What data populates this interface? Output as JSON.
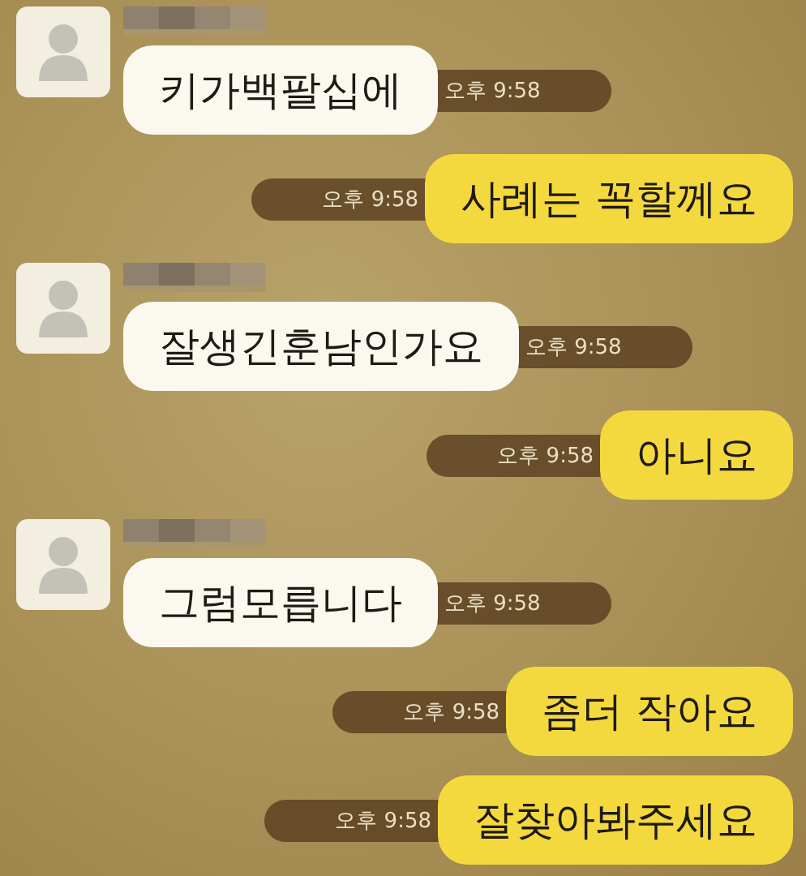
{
  "messages": [
    {
      "kind": "received",
      "text": "키가백팔십에",
      "time": "오후 9:58"
    },
    {
      "kind": "sent",
      "text": "사례는 꼭할께요",
      "time": "오후 9:58"
    },
    {
      "kind": "received",
      "text": "잘생긴훈남인가요",
      "time": "오후 9:58"
    },
    {
      "kind": "sent",
      "text": "아니요",
      "time": "오후 9:58"
    },
    {
      "kind": "received",
      "text": "그럼모릅니다",
      "time": "오후 9:58"
    },
    {
      "kind": "sent",
      "text": "좀더 작아요",
      "time": "오후 9:58"
    },
    {
      "kind": "sent",
      "text": "잘찾아봐주세요",
      "time": "오후 9:58"
    }
  ]
}
